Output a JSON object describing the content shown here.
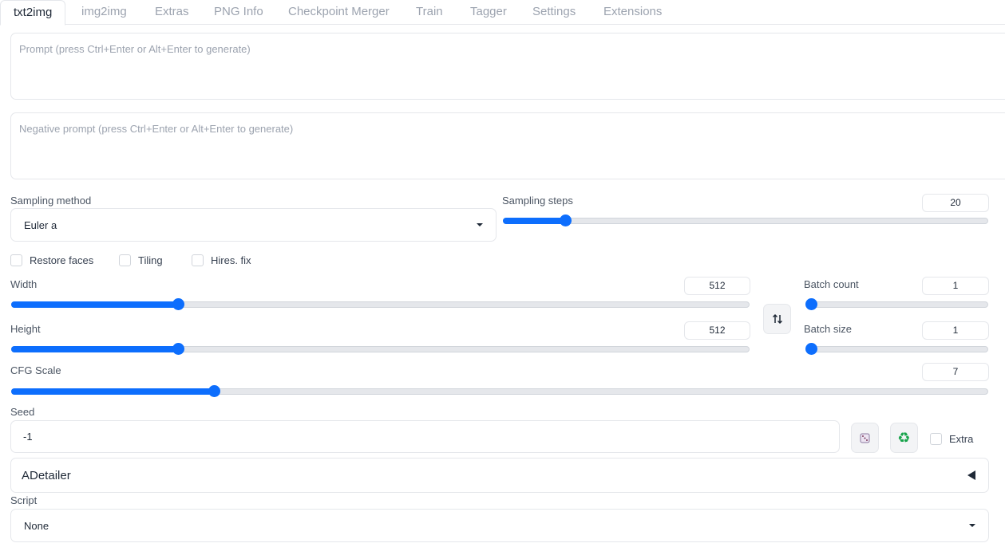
{
  "tabs": [
    "txt2img",
    "img2img",
    "Extras",
    "PNG Info",
    "Checkpoint Merger",
    "Train",
    "Tagger",
    "Settings",
    "Extensions"
  ],
  "active_tab": "txt2img",
  "prompt": {
    "placeholder": "Prompt (press Ctrl+Enter or Alt+Enter to generate)"
  },
  "negative_prompt": {
    "placeholder": "Negative prompt (press Ctrl+Enter or Alt+Enter to generate)"
  },
  "sampling_method": {
    "label": "Sampling method",
    "value": "Euler a"
  },
  "sampling_steps": {
    "label": "Sampling steps",
    "value": 20,
    "min": 1,
    "max": 150
  },
  "checkboxes": {
    "restore_faces": "Restore faces",
    "tiling": "Tiling",
    "hires_fix": "Hires. fix"
  },
  "width": {
    "label": "Width",
    "value": 512,
    "min": 64,
    "max": 2048
  },
  "height": {
    "label": "Height",
    "value": 512,
    "min": 64,
    "max": 2048
  },
  "swap_icon": "swap-vertical-icon",
  "batch_count": {
    "label": "Batch count",
    "value": 1,
    "min": 1,
    "max": 100
  },
  "batch_size": {
    "label": "Batch size",
    "value": 1,
    "min": 1,
    "max": 8
  },
  "cfg_scale": {
    "label": "CFG Scale",
    "value": 7,
    "min": 1,
    "max": 30
  },
  "seed": {
    "label": "Seed",
    "value": "-1",
    "extra_label": "Extra"
  },
  "adetailer": {
    "label": "ADetailer"
  },
  "script": {
    "label": "Script",
    "value": "None"
  },
  "colors": {
    "accent": "#0d6efd",
    "border": "#e5e7eb"
  }
}
